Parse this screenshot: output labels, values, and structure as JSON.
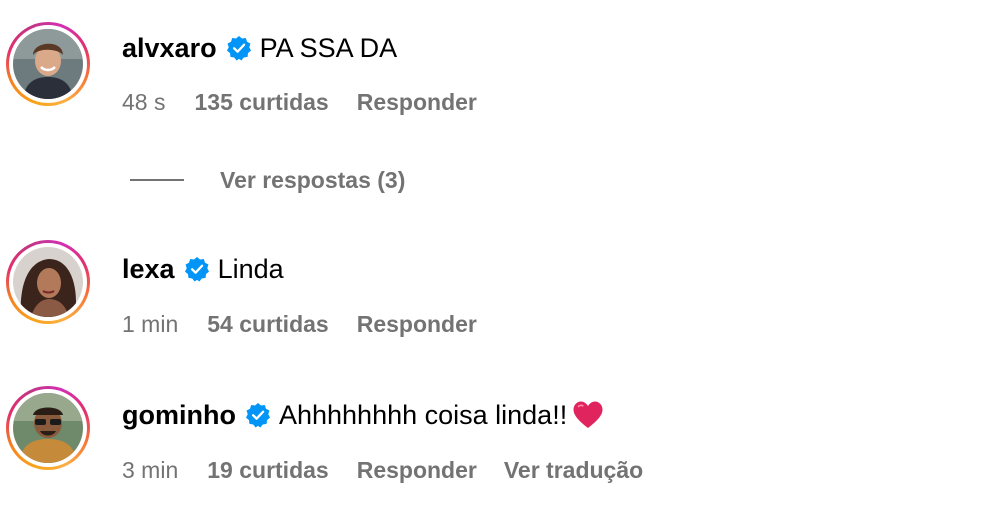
{
  "comments": [
    {
      "username": "alvxaro",
      "text": "PA SSA DA",
      "time": "48 s",
      "likes": "135 curtidas",
      "reply_label": "Responder",
      "verified": true,
      "avatar_icon": "man-portrait-avatar"
    },
    {
      "username": "lexa",
      "text": "Linda",
      "time": "1 min",
      "likes": "54 curtidas",
      "reply_label": "Responder",
      "verified": true,
      "avatar_icon": "woman-portrait-avatar"
    },
    {
      "username": "gominho",
      "text": "Ahhhhhhhh coisa linda!!",
      "emoji": "red-heart-icon",
      "time": "3 min",
      "likes": "19 curtidas",
      "reply_label": "Responder",
      "translate_label": "Ver tradução",
      "verified": true,
      "avatar_icon": "man-sunglasses-avatar"
    }
  ],
  "view_replies": {
    "label": "Ver respostas (3)"
  },
  "colors": {
    "verified_blue": "#0095f6",
    "meta_gray": "#737373",
    "heart_red": "#e0245e",
    "text_black": "#000000"
  }
}
